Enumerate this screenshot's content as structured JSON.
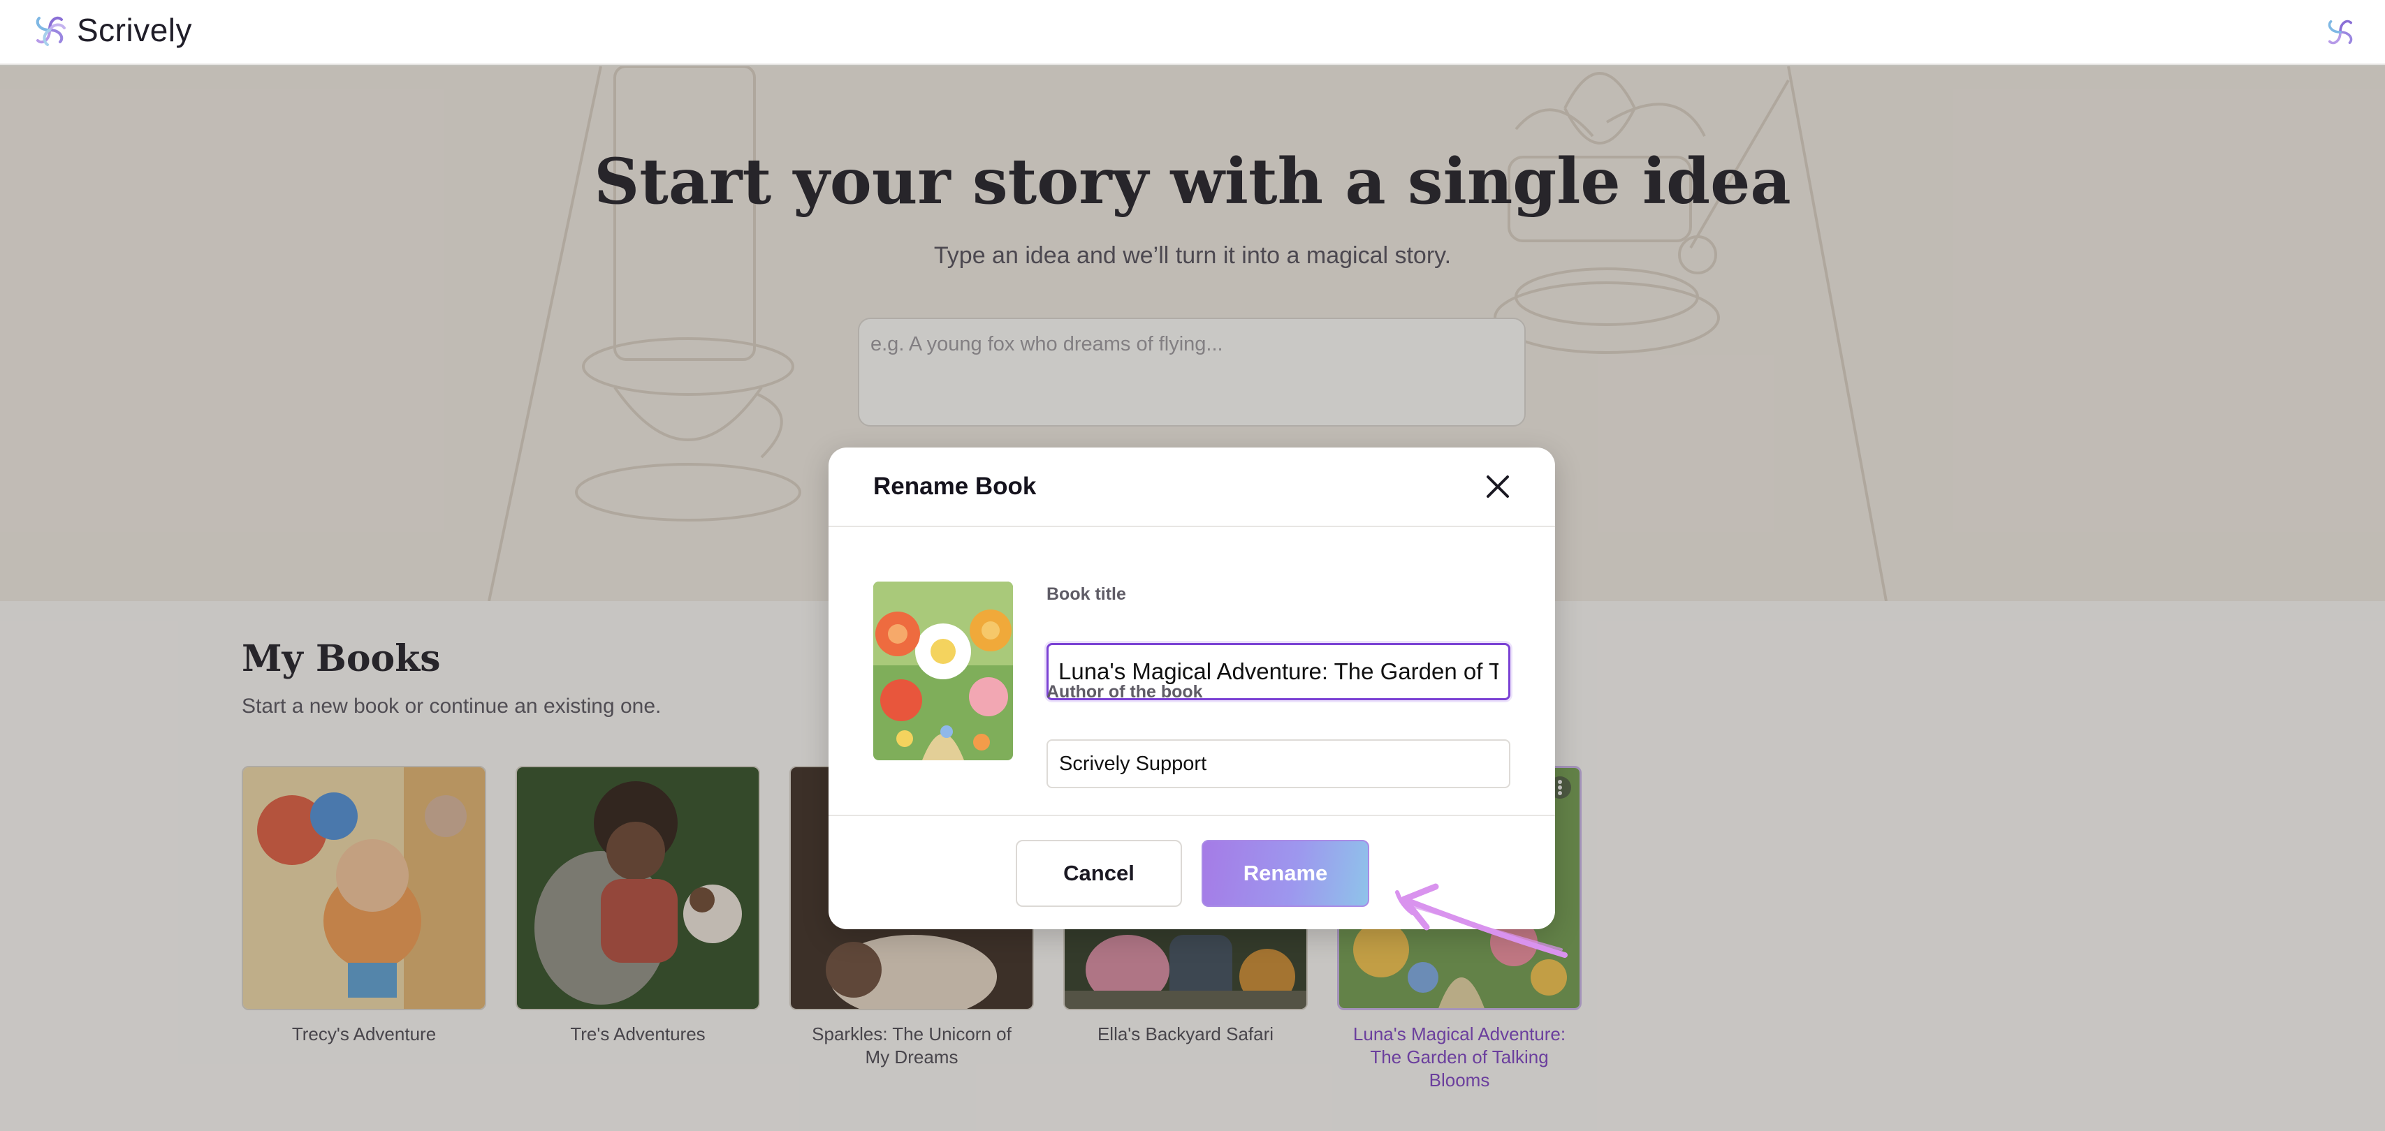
{
  "app": {
    "brand_name": "Scrively",
    "logo_icon": "swirl-logo-icon",
    "accent_color": "#7b42d4"
  },
  "hero": {
    "title": "Start your story with a single idea",
    "subtitle": "Type an idea and we’ll turn it into a magical story.",
    "idea_placeholder": "e.g. A young fox who dreams of flying..."
  },
  "library": {
    "title": "My Books",
    "subtitle": "Start a new book or continue an existing one.",
    "books": [
      {
        "title": "Trecy's Adventure"
      },
      {
        "title": "Tre's Adventures"
      },
      {
        "title": "Sparkles: The Unicorn of My Dreams"
      },
      {
        "title": "Ella's Backyard Safari"
      },
      {
        "title": "Luna's Magical Adventure: The Garden of Talking Blooms",
        "selected": true
      }
    ]
  },
  "modal": {
    "title": "Rename Book",
    "close_icon": "close-icon",
    "book_title_label": "Book title",
    "book_title_value": "Luna's Magical Adventure: The Garden of Talking Blooms",
    "author_label": "Author of the book",
    "author_value": "Scrively Support",
    "cancel_label": "Cancel",
    "rename_label": "Rename"
  }
}
